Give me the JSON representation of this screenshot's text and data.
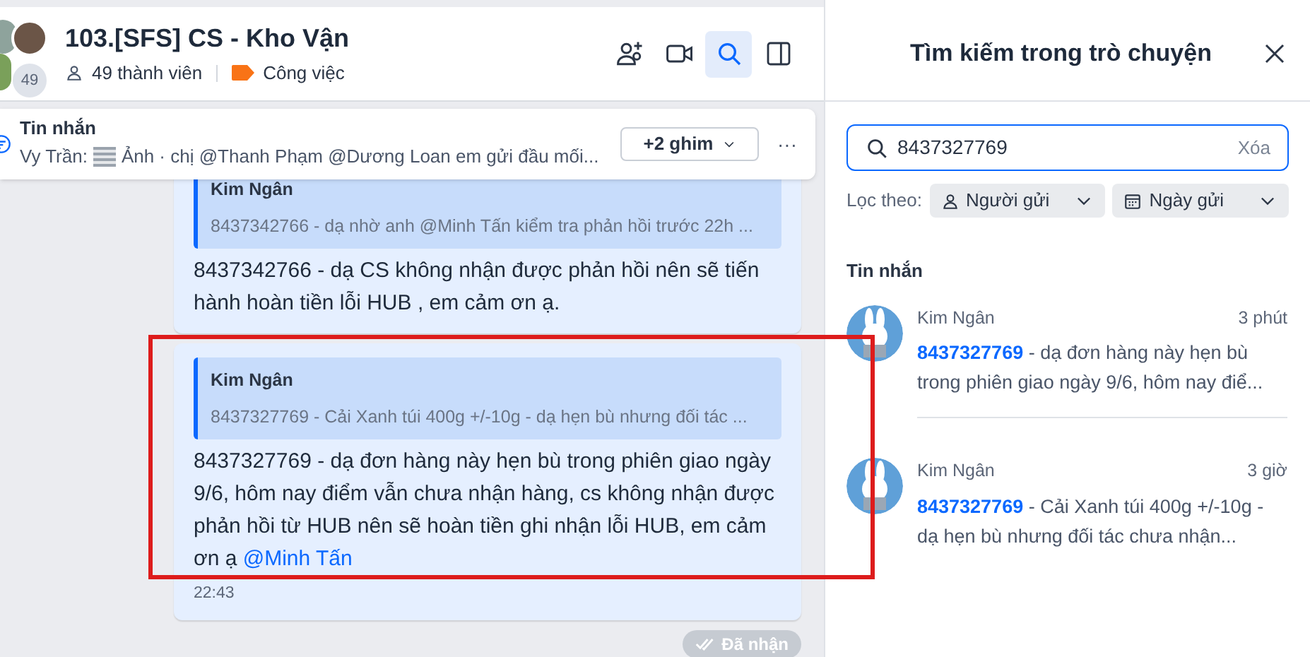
{
  "header": {
    "title": "103.[SFS] CS - Kho Vận",
    "avatar_count": "49",
    "members": "49 thành viên",
    "tag": {
      "label": "Công việc",
      "color": "#f97316"
    },
    "actions": [
      {
        "kind": "add-member",
        "selected": false
      },
      {
        "kind": "video",
        "selected": false
      },
      {
        "kind": "search",
        "selected": true
      },
      {
        "kind": "panel",
        "selected": false
      }
    ]
  },
  "pinned": {
    "title": "Tin nhắn",
    "sender": "Vy Trần:",
    "preview": "Ảnh · chị @Thanh Phạm @Dương Loan em gửi đầu mối...",
    "pins": "+2 ghim",
    "more": "···"
  },
  "messages": [
    {
      "quote_author": "Kim Ngân",
      "quote_text": "8437342766 - dạ nhờ anh @Minh Tấn kiểm tra phản hồi trước 22h ...",
      "text": "8437342766  - dạ CS không  nhận được phản hồi nên sẽ tiến hành hoàn tiền lỗi HUB , em cảm ơn ạ."
    },
    {
      "quote_author": "Kim Ngân",
      "quote_text": "8437327769 - Cải Xanh túi 400g +/-10g - dạ hẹn bù nhưng đối tác ...",
      "text": "8437327769  - dạ đơn hàng này hẹn bù trong phiên giao ngày 9/6, hôm nay điểm vẫn chưa nhận hàng, cs không nhận được phản hồi từ HUB nên sẽ hoàn tiền ghi nhận lỗi HUB, em cảm ơn ạ",
      "mention": "@Minh Tấn",
      "time": "22:43"
    }
  ],
  "status": "Đã nhận",
  "search_panel": {
    "title": "Tìm kiếm trong trò chuyện",
    "query": "8437327769",
    "clear": "Xóa",
    "filter_label": "Lọc theo:",
    "filters": [
      {
        "kind": "person",
        "label": "Người gửi"
      },
      {
        "kind": "calendar",
        "label": "Ngày gửi"
      }
    ],
    "section": "Tin nhắn",
    "results": [
      {
        "name": "Kim Ngân",
        "time": "3 phút",
        "text": "**8437327769** - dạ đơn hàng này hẹn bù trong phiên giao ngày 9/6, hôm nay điể..."
      },
      {
        "name": "Kim Ngân",
        "time": "3 giờ",
        "text": "**8437327769** - Cải Xanh túi 400g +/-10g - dạ hẹn bù nhưng đối tác chưa nhận..."
      }
    ]
  }
}
